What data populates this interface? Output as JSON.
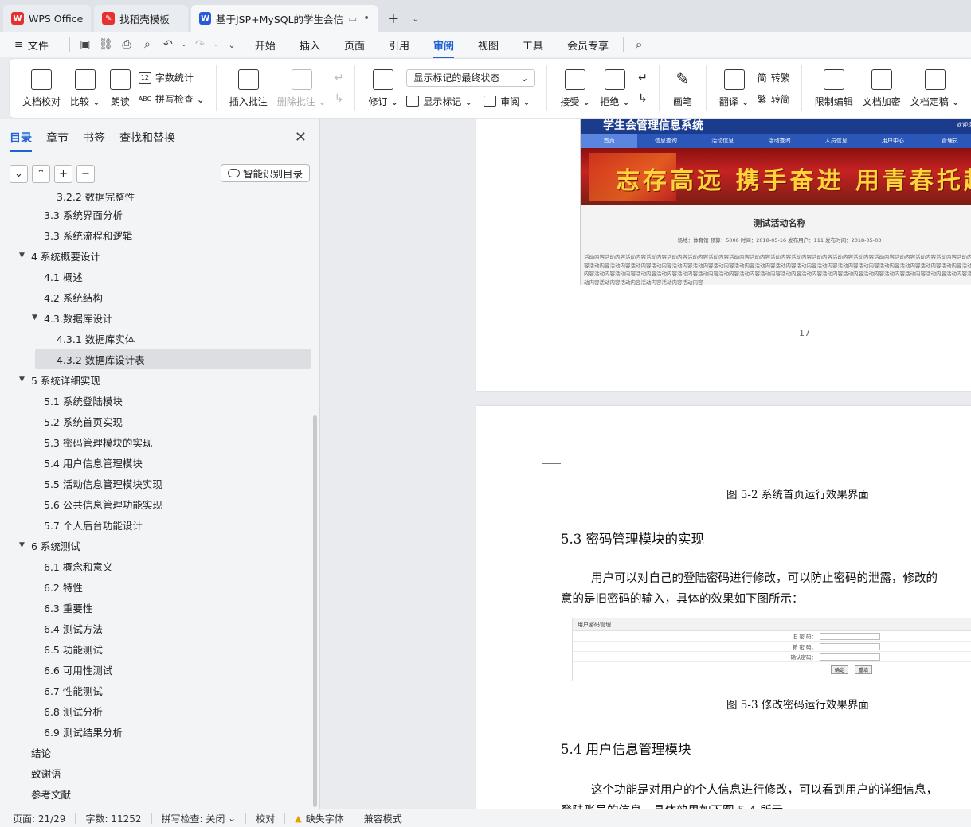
{
  "tabs": [
    {
      "label": "WPS Office",
      "logo": "W",
      "color": "#e8312f"
    },
    {
      "label": "找稻壳模板",
      "logo": "稻",
      "color": "#e8312f"
    },
    {
      "label": "基于JSP+MySQL的学生会信息",
      "logo": "W",
      "color": "#2a5bd7"
    }
  ],
  "menu": {
    "file": "文件",
    "tabs": [
      "开始",
      "插入",
      "页面",
      "引用",
      "审阅",
      "视图",
      "工具",
      "会员专享"
    ],
    "active": "审阅"
  },
  "ribbon": {
    "doc_check": "文档校对",
    "compare": "比较",
    "read_aloud": "朗读",
    "word_count": "字数统计",
    "spell_check": "拼写检查",
    "insert_comment": "插入批注",
    "delete_comment": "删除批注",
    "track_changes": "修订",
    "markup_state": "显示标记的最终状态",
    "show_markup": "显示标记",
    "review": "审阅",
    "accept": "接受",
    "reject": "拒绝",
    "pen": "画笔",
    "translate": "翻译",
    "to_traditional": "转繁",
    "to_simplified": "转简",
    "restrict_edit": "限制编辑",
    "encrypt": "文档加密",
    "finalize": "文档定稿"
  },
  "side_panel": {
    "tabs": [
      "目录",
      "章节",
      "书签",
      "查找和替换"
    ],
    "active_tab": "目录",
    "smart_toc": "智能识别目录",
    "toc": [
      {
        "label": "3.2.2 数据完整性",
        "level": 3
      },
      {
        "label": "3.3 系统界面分析",
        "level": 2
      },
      {
        "label": "3.3 系统流程和逻辑",
        "level": 2
      },
      {
        "label": "4 系统概要设计",
        "level": 1,
        "expanded": true
      },
      {
        "label": "4.1 概述",
        "level": 2
      },
      {
        "label": "4.2 系统结构",
        "level": 2
      },
      {
        "label": "4.3.数据库设计",
        "level": 2,
        "expanded": true
      },
      {
        "label": "4.3.1 数据库实体",
        "level": 3
      },
      {
        "label": "4.3.2 数据库设计表",
        "level": 3,
        "selected": true
      },
      {
        "label": "5 系统详细实现",
        "level": 1,
        "expanded": true
      },
      {
        "label": "5.1  系统登陆模块",
        "level": 2
      },
      {
        "label": "5.2  系统首页实现",
        "level": 2
      },
      {
        "label": "5.3  密码管理模块的实现",
        "level": 2
      },
      {
        "label": "5.4  用户信息管理模块",
        "level": 2
      },
      {
        "label": "5.5  活动信息管理模块实现",
        "level": 2
      },
      {
        "label": "5.6 公共信息管理功能实现",
        "level": 2
      },
      {
        "label": "5.7 个人后台功能设计",
        "level": 2
      },
      {
        "label": "6 系统测试",
        "level": 1,
        "expanded": true
      },
      {
        "label": "6.1 概念和意义",
        "level": 2
      },
      {
        "label": "6.2 特性",
        "level": 2
      },
      {
        "label": "6.3 重要性",
        "level": 2
      },
      {
        "label": "6.4 测试方法",
        "level": 2
      },
      {
        "label": "6.5  功能测试",
        "level": 2
      },
      {
        "label": "6.6 可用性测试",
        "level": 2
      },
      {
        "label": "6.7 性能测试",
        "level": 2
      },
      {
        "label": "6.8 测试分析",
        "level": 2
      },
      {
        "label": "6.9 测试结果分析",
        "level": 2
      },
      {
        "label": "结论",
        "level": 1
      },
      {
        "label": "致谢语",
        "level": 1
      },
      {
        "label": "参考文献",
        "level": 1
      }
    ]
  },
  "document": {
    "site_title": "学生会管理信息系统",
    "site_corner": "欢迎您",
    "site_nav": [
      "首页",
      "信息查询",
      "活动信息",
      "活动查询",
      "人员信息",
      "用户中心",
      "管理员"
    ],
    "banner_slogan": "志存高远 携手奋进 用青春托起中国梦",
    "activity_title": "测试活动名称",
    "activity_meta": "场地：体育馆  预算：5000  时间：2018-05-16  发布用户：111  发布时间：2018-05-03",
    "activity_body": "活动内容活动内容活动内容活动内容活动内容活动内容活动内容活动内容活动内容活动内容活动内容活动内容活动内容活动内容活动内容活动内容活动内容活动内容活动内容活动内容活动内容活动内容活动内容活动内容活动内容活动内容活动内容活动内容活动内容活动内容活动内容活动内容活动内容活动内容活动内容活动内容活动内容活动内容活动内容活动内容活动内容活动内容活动内容活动内容活动内容活动内容活动内容活动内容活动内容活动内容活动内容活动内容活动内容活动内容活动内容活动内容活动内容活动内容活动内容活动内容活动内容活动内容",
    "page_number": "17",
    "caption_5_2": "图 5-2  系统首页运行效果界面",
    "heading_5_3": "5.3  密码管理模块的实现",
    "para_5_3_line1": "用户可以对自己的登陆密码进行修改，可以防止密码的泄露，修改的",
    "para_5_3_line2": "意的是旧密码的输入，具体的效果如下图所示：",
    "pw_panel_title": "用户密码管理",
    "pw_labels": [
      "旧 密 码：",
      "新 密 码：",
      "确认密码："
    ],
    "pw_buttons": [
      "确定",
      "重填"
    ],
    "caption_5_3": "图 5-3  修改密码运行效果界面",
    "heading_5_4": "5.4  用户信息管理模块",
    "para_5_4_line1": "这个功能是对用户的个人信息进行修改，可以看到用户的详细信息，",
    "para_5_4_line2": "登陆账号的信息，具体效果如下图 5-4 所示"
  },
  "status": {
    "page": "页面: 21/29",
    "words": "字数: 11252",
    "spell": "拼写检查: 关闭",
    "proof": "校对",
    "missing_font": "缺失字体",
    "compat": "兼容模式"
  }
}
